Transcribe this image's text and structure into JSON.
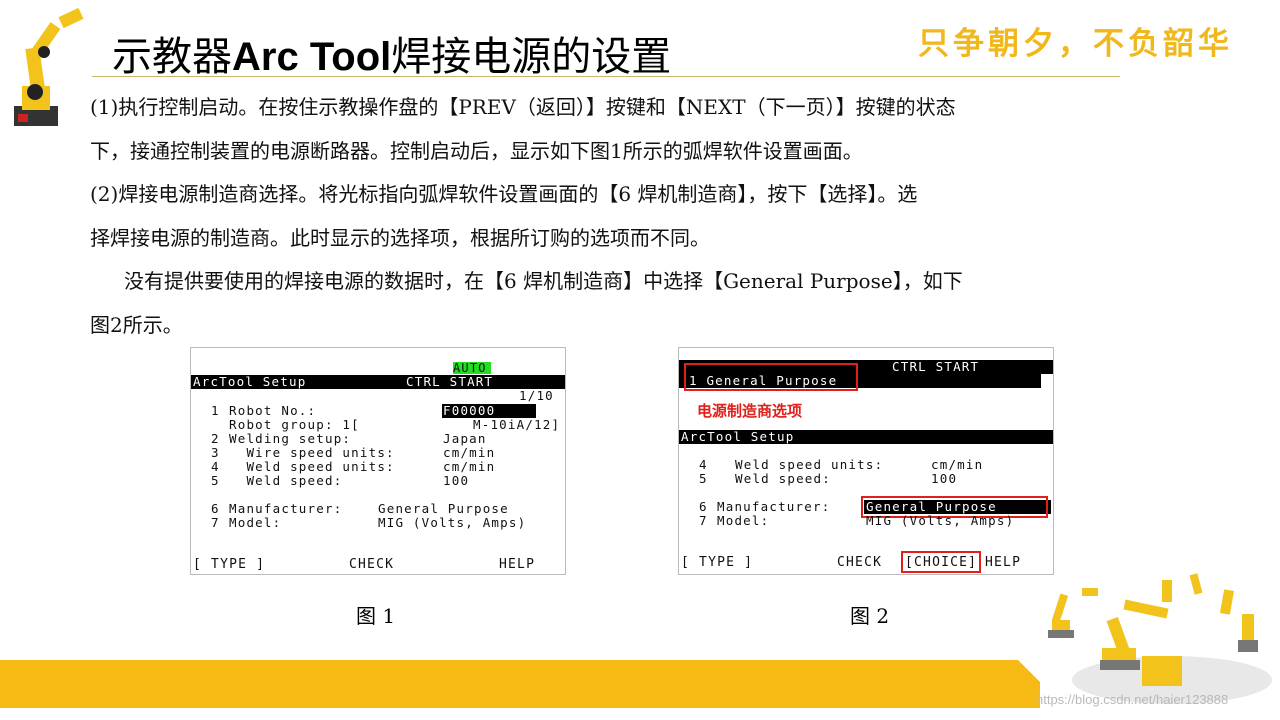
{
  "slide": {
    "title_part1": "示教器",
    "title_en": "Arc Tool",
    "title_part2": "焊接电源的设置",
    "slogan": "只争朝夕，不负韶华",
    "paragraphs": [
      "(1)执行控制启动。在按住示教操作盘的【PREV（返回）】按键和【NEXT（下一页）】按键的状态",
      "下，接通控制装置的电源断路器。控制启动后，显示如下图1所示的弧焊软件设置画面。",
      "(2)焊接电源制造商选择。将光标指向弧焊软件设置画面的【6 焊机制造商】，按下【选择】。选",
      "择焊接电源的制造商。此时显示的选择项，根据所订购的选项而不同。",
      "没有提供要使用的焊接电源的数据时，在【6 焊机制造商】中选择【General Purpose】，如下",
      "图2所示。"
    ],
    "caption1": "图 1",
    "caption2": "图 2",
    "watermark": "https://blog.csdn.net/haier123888"
  },
  "screen1": {
    "status": "AUTO",
    "header_left": "ArcTool Setup",
    "header_right": "CTRL START",
    "page": "1/10",
    "rows": [
      {
        "num": "1",
        "label": "Robot No.:",
        "value": "F00000"
      },
      {
        "num": "",
        "label": "Robot group: 1[",
        "value": "M-10iA/12]"
      },
      {
        "num": "2",
        "label": "Welding setup:",
        "value": "Japan"
      },
      {
        "num": "3",
        "label": "  Wire speed units:",
        "value": "cm/min"
      },
      {
        "num": "4",
        "label": "  Weld speed units:",
        "value": "cm/min"
      },
      {
        "num": "5",
        "label": "  Weld speed:",
        "value": "100"
      },
      {
        "num": "6",
        "label": "Manufacturer:",
        "value": "General Purpose"
      },
      {
        "num": "7",
        "label": "Model:",
        "value": "MIG (Volts, Amps)"
      }
    ],
    "keys": [
      "[ TYPE ]",
      "CHECK",
      "HELP"
    ]
  },
  "screen2": {
    "header_right": "CTRL START",
    "option": "1 General Purpose",
    "annotation": "电源制造商选项",
    "header_left": "ArcTool Setup",
    "rows": [
      {
        "num": "4",
        "label": "Weld speed units:",
        "value": "cm/min"
      },
      {
        "num": "5",
        "label": "Weld speed:",
        "value": "100"
      },
      {
        "num": "6",
        "label": "Manufacturer:",
        "value": "General Purpose"
      },
      {
        "num": "7",
        "label": "Model:",
        "value": "MIG (Volts, Amps)"
      }
    ],
    "keys": [
      "[ TYPE ]",
      "CHECK",
      "[CHOICE]",
      "HELP"
    ]
  },
  "colors": {
    "accent": "#f7ba14",
    "slogan": "#f1b81c",
    "highlight": "#e0201b",
    "status": "#22dd22"
  }
}
